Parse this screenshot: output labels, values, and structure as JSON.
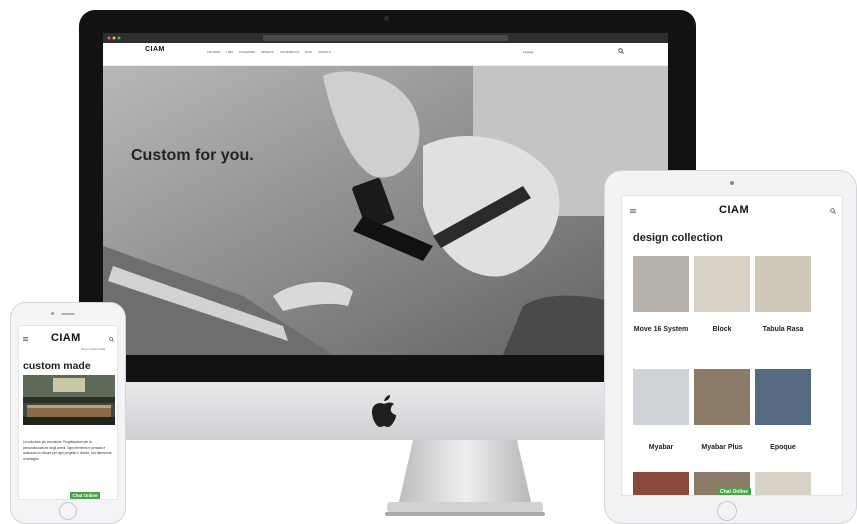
{
  "desktop": {
    "logo": "CIAM",
    "nav_links": [
      "CHI SIAMO",
      "LABS",
      "COLLEZIONE",
      "PROGETTI",
      "SOSTENIBILITÀ",
      "BLOG",
      "CONTATTI"
    ],
    "lang": "Language",
    "hero_title": "Custom for you."
  },
  "tablet": {
    "logo": "CIAM",
    "heading": "design collection",
    "items": [
      "Move 16 System",
      "Block",
      "Tabula Rasa",
      "Myabar",
      "Myabar Plus",
      "Epoque"
    ],
    "chat_button": "Chat Online"
  },
  "phone": {
    "logo": "CIAM",
    "breadcrumb": "Home / Custom made",
    "heading": "custom made",
    "body_text": "La soluzione più innovativa. Progettazione per la personalizzazione degli arredi. Ogni elemento è pensato e realizzato su misura per ogni progetto e cliente, con attenzione al dettaglio.",
    "chat_button": "Chat Online"
  }
}
